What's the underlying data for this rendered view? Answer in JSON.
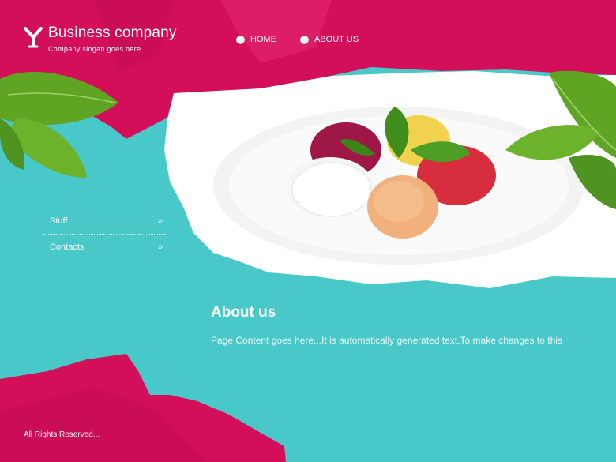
{
  "header": {
    "brand_title": "Business company",
    "brand_slogan": "Company slogan goes here",
    "logo_glyph": "Y"
  },
  "nav": {
    "items": [
      {
        "label": "HOME",
        "active": false
      },
      {
        "label": "ABOUT US",
        "active": true
      }
    ]
  },
  "sidebar": {
    "items": [
      {
        "label": "Stuff",
        "arrow": "»"
      },
      {
        "label": "Contacts",
        "arrow": "»"
      }
    ]
  },
  "content": {
    "heading": "About us",
    "text": "Page Content goes here...It is automatically generated text.To make changes to this"
  },
  "footer": {
    "text": "All Rights Reserved..."
  },
  "colors": {
    "magenta": "#d40f5a",
    "teal": "#48c8c9",
    "white_plate": "#ffffff",
    "leaf_green": "#5fa523"
  },
  "icons": {
    "logo": "y-letter-logo-icon",
    "nav_bullet": "radio-dot-icon",
    "sidebar_arrow": "double-chevron-right-icon"
  }
}
